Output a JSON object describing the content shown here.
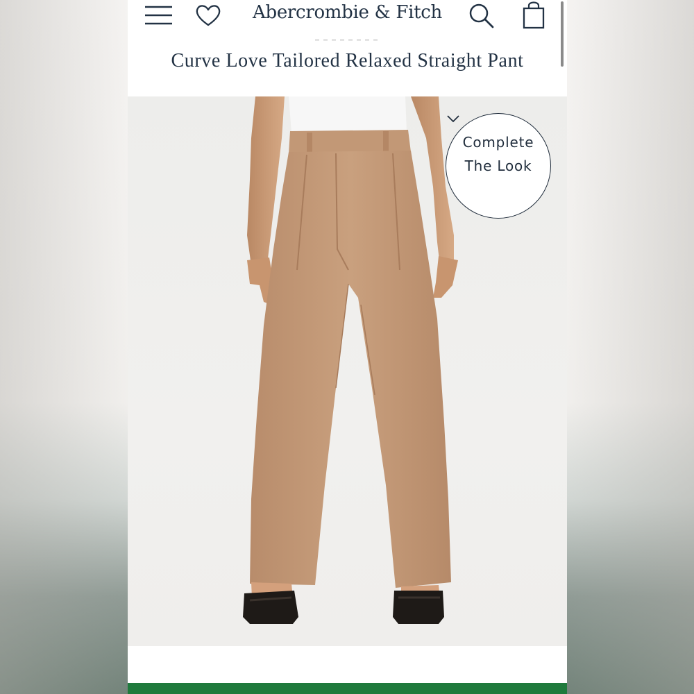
{
  "header": {
    "brand": "Abercrombie & Fitch",
    "icons": [
      "menu-icon",
      "heart-icon",
      "search-icon",
      "bag-icon"
    ]
  },
  "product": {
    "title": "Curve Love Tailored Relaxed Straight Pant"
  },
  "overlay": {
    "complete_look_line1": "Complete",
    "complete_look_line2": "The Look",
    "chevron": "chevron-down-icon"
  },
  "colors": {
    "brand_navy": "#223244",
    "pant_tan": "#c49a78",
    "footer_green": "#1f7a3c"
  }
}
